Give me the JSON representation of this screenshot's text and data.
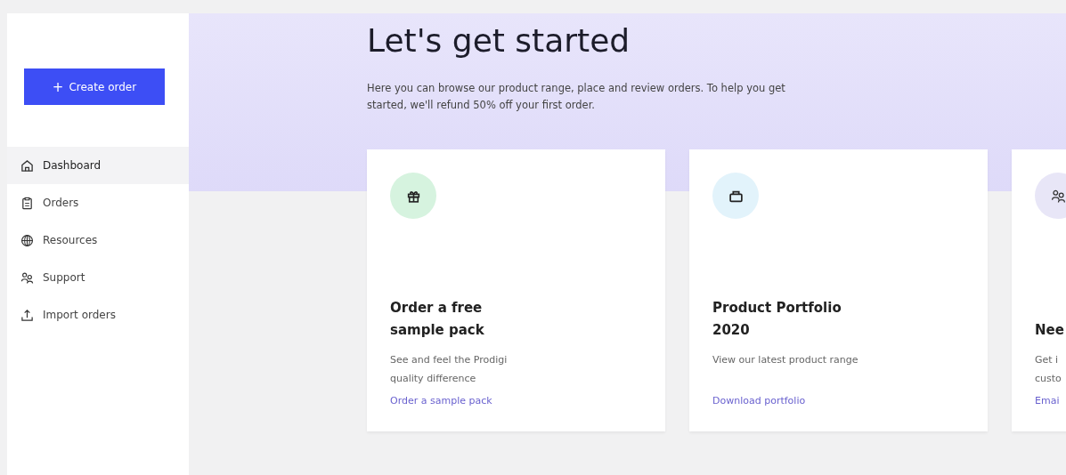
{
  "sidebar": {
    "create_button": {
      "icon": "+",
      "label": "Create order"
    },
    "items": [
      {
        "kind": "home",
        "label": "Dashboard",
        "selected": true
      },
      {
        "kind": "clipboard",
        "label": "Orders",
        "selected": false
      },
      {
        "kind": "globe",
        "label": "Resources",
        "selected": false
      },
      {
        "kind": "people",
        "label": "Support",
        "selected": false
      },
      {
        "kind": "upload",
        "label": "Import orders",
        "selected": false
      }
    ]
  },
  "hero": {
    "title": "Let's get started",
    "text": "Here you can browse our product range, place and review orders. To help you get started, we'll refund 50% off your first order."
  },
  "cards": [
    {
      "kind": "gift",
      "color": "#d6f3df",
      "title_lines": [
        "Order a free",
        "sample pack"
      ],
      "description_lines": [
        "See and feel the Prodigi",
        "quality difference"
      ],
      "link": "Order a sample pack"
    },
    {
      "kind": "bag",
      "color": "#e2f3fb",
      "title_lines": [
        "Product Portfolio",
        "2020"
      ],
      "description_lines": [
        "View our latest product range"
      ],
      "link": "Download portfolio"
    },
    {
      "kind": "people",
      "color": "#e8e6f7",
      "title_lines": [
        "Nee"
      ],
      "description_lines": [
        "Get i",
        "custo"
      ],
      "link": "Emai"
    }
  ]
}
